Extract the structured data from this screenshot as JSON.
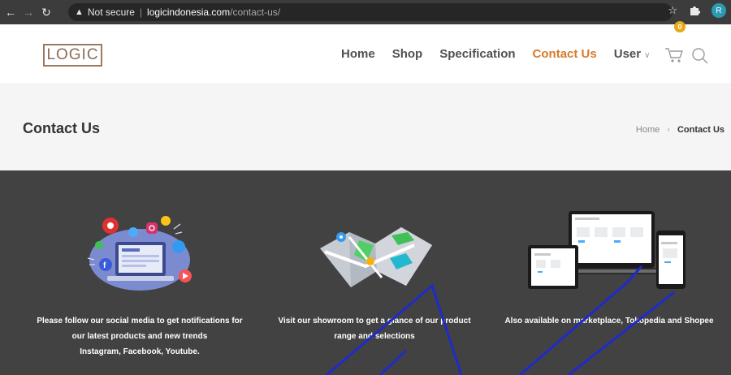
{
  "browser": {
    "security_label": "Not secure",
    "url_host": "logicindonesia.com",
    "url_path": "/contact-us/",
    "profile_initial": "R"
  },
  "header": {
    "logo": "LOGIC",
    "menu": [
      {
        "label": "Home"
      },
      {
        "label": "Shop"
      },
      {
        "label": "Specification"
      },
      {
        "label": "Contact Us",
        "active": true
      },
      {
        "label": "User",
        "has_dropdown": true
      }
    ],
    "cart_count": "0"
  },
  "title_band": {
    "title": "Contact Us",
    "breadcrumb": {
      "home": "Home",
      "current": "Contact Us"
    }
  },
  "info": [
    {
      "icon": "social-media-laptop-illustration",
      "lines": [
        "Please follow our social media to get notifications for",
        "our latest products and new trends",
        "Instagram, Facebook, Youtube."
      ]
    },
    {
      "icon": "folded-map-illustration",
      "lines": [
        "Visit our showroom to get a glance of our product",
        "range and selections"
      ]
    },
    {
      "icon": "devices-illustration",
      "lines": [
        "Also available on marketplace, Tokopedia and Shopee"
      ]
    }
  ],
  "colors": {
    "accent": "#d8792a",
    "dark_band": "#424242",
    "logo": "#9a7a63",
    "badge": "#e6a817"
  }
}
